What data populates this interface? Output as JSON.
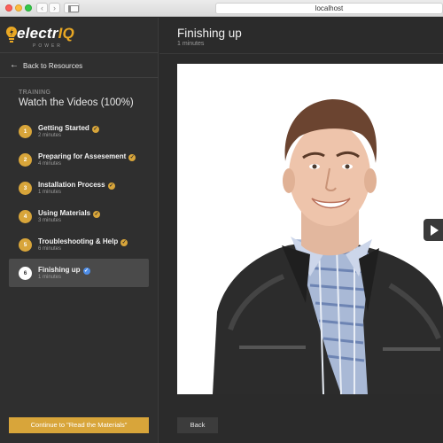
{
  "browser": {
    "url": "localhost",
    "back_glyph": "‹",
    "forward_glyph": "›"
  },
  "sidebar": {
    "logo": {
      "primary": "electr",
      "accent": "IQ",
      "sub": "POWER"
    },
    "back_label": "Back to Resources",
    "section_label": "TRAINING",
    "section_title": "Watch the Videos (100%)",
    "steps": [
      {
        "number": "1",
        "title": "Getting Started",
        "duration": "2 minutes",
        "status": "complete"
      },
      {
        "number": "2",
        "title": "Preparing for Assesement",
        "duration": "4 minutes",
        "status": "complete"
      },
      {
        "number": "3",
        "title": "Installation Process",
        "duration": "1 minutes",
        "status": "complete"
      },
      {
        "number": "4",
        "title": "Using Materials",
        "duration": "3 minutes",
        "status": "complete"
      },
      {
        "number": "5",
        "title": "Troubleshooting & Help",
        "duration": "6 minutes",
        "status": "complete"
      },
      {
        "number": "6",
        "title": "Finishing up",
        "duration": "1 minutes",
        "status": "active"
      }
    ],
    "continue_label": "Continue to \"Read the Materials\""
  },
  "main": {
    "video_title": "Finishing up",
    "video_duration": "1 minutes",
    "back_label": "Back"
  },
  "colors": {
    "accent": "#d8a53a",
    "active_check": "#4f8ee8",
    "background": "#2b2b2b"
  },
  "icons": {
    "back": "arrow-left-icon",
    "step_check": "check-circle-icon",
    "play": "play-icon"
  }
}
